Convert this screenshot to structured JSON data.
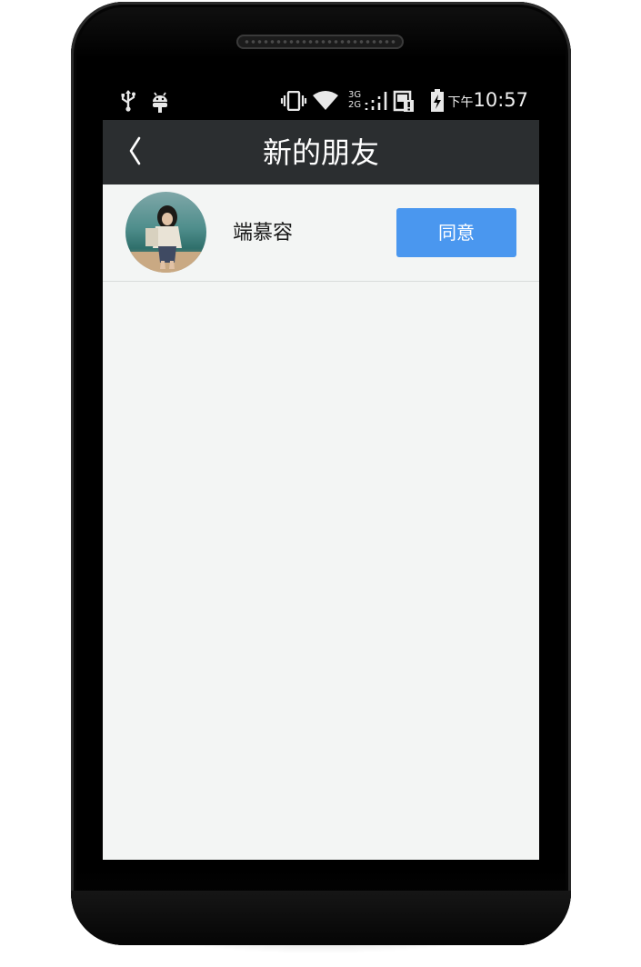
{
  "status_bar": {
    "icons": [
      "usb-icon",
      "android-debug-icon",
      "vibrate-icon",
      "wifi-icon",
      "network-3g-2g-icon",
      "signal-icon",
      "sim-alert-icon",
      "battery-charging-icon"
    ],
    "network_top": "3G",
    "network_bottom": "2G",
    "time_prefix": "下午",
    "time": "10:57"
  },
  "header": {
    "back_icon": "chevron-left-icon",
    "title": "新的朋友"
  },
  "friend_requests": [
    {
      "name": "端慕容",
      "action_label": "同意"
    }
  ],
  "colors": {
    "title_bar": "#2b2e30",
    "screen_bg": "#f3f5f4",
    "accent_button": "#4a97ef"
  }
}
